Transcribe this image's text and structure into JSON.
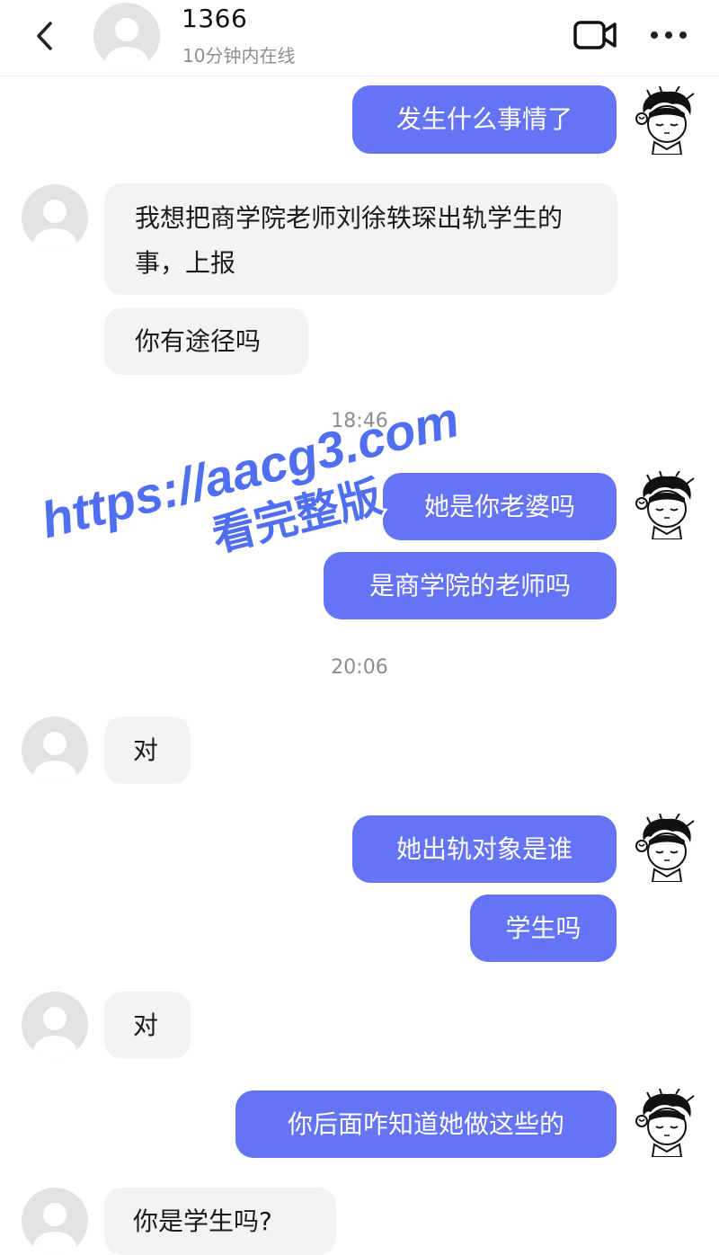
{
  "header": {
    "contact_name": "1366",
    "status": "10分钟内在线"
  },
  "timestamps": {
    "t1": "18:46",
    "t2": "20:06"
  },
  "messages": {
    "m1": "发生什么事情了",
    "m2": "我想把商学院老师刘徐轶琛出轨学生的事，上报",
    "m3": "你有途径吗",
    "m4": "她是你老婆吗",
    "m5": "是商学院的老师吗",
    "m6": "对",
    "m7": "她出轨对象是谁",
    "m8": "学生吗",
    "m9": "对",
    "m10": "你后面咋知道她做这些的",
    "m11": "你是学生吗?"
  },
  "watermark": {
    "url": "https://aacg3.com",
    "caption": "看完整版"
  },
  "colors": {
    "outgoing_bubble": "#6573f5",
    "incoming_bubble": "#f3f3f5",
    "watermark": "#4f6ef0"
  },
  "icons": {
    "back": "chevron-left-icon",
    "video": "video-camera-icon",
    "more": "more-horizontal-icon",
    "default_avatar": "user-silhouette-icon"
  }
}
